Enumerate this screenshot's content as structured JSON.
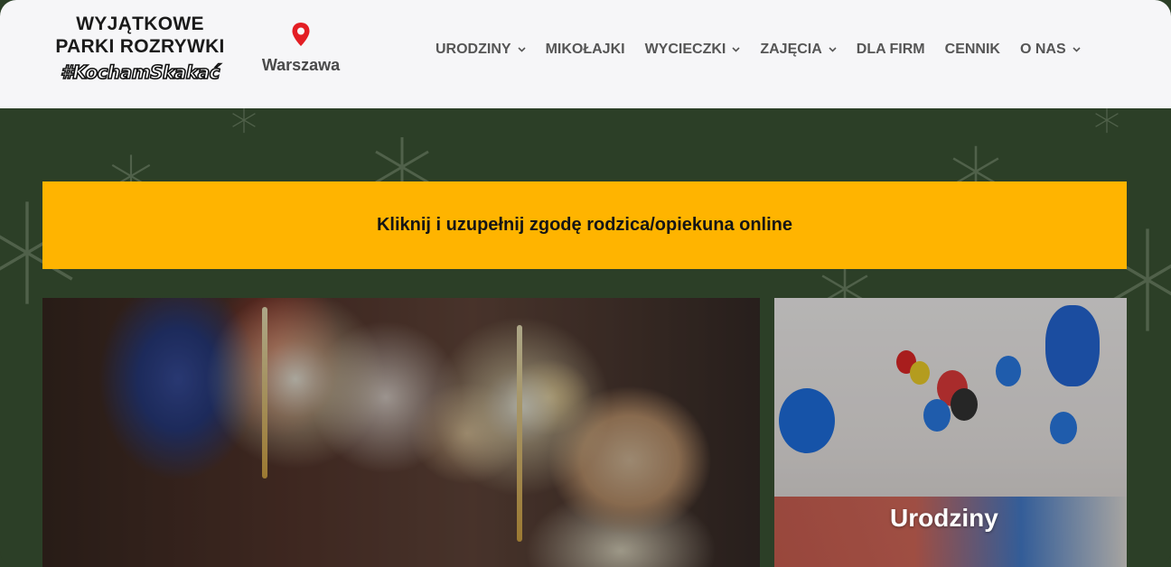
{
  "header": {
    "logo": {
      "line1": "WYJĄTKOWE",
      "line2": "PARKI ROZRYWKI",
      "tagline": "#KochamSkakać"
    },
    "location": {
      "label": "Warszawa",
      "icon": "map-pin-icon",
      "color": "#e31e24"
    },
    "nav": [
      {
        "label": "URODZINY",
        "has_dropdown": true
      },
      {
        "label": "MIKOŁAJKI",
        "has_dropdown": false
      },
      {
        "label": "WYCIECZKI",
        "has_dropdown": true
      },
      {
        "label": "ZAJĘCIA",
        "has_dropdown": true
      },
      {
        "label": "DLA FIRM",
        "has_dropdown": false
      },
      {
        "label": "CENNIK",
        "has_dropdown": false
      },
      {
        "label": "O NAS",
        "has_dropdown": true
      }
    ]
  },
  "banner": {
    "text": "Kliknij i uzupełnij zgodę rodzica/opiekuna online",
    "color": "#ffb400"
  },
  "cards": {
    "left": {
      "image": "birthday-cake-sparklers-photo"
    },
    "right": {
      "title": "Urodziny",
      "image": "birthday-party-room-photo"
    }
  },
  "colors": {
    "background": "#2c3f27",
    "header_bg": "#f6f6f8",
    "nav_text": "#555555"
  }
}
